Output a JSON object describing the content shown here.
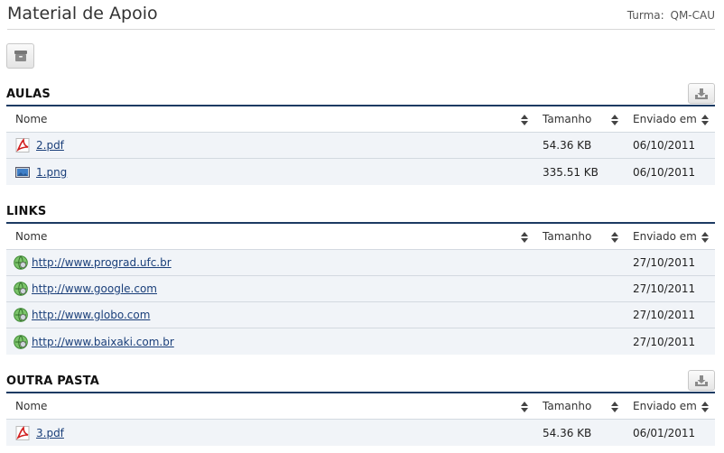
{
  "header": {
    "title": "Material de Apoio",
    "turma_label": "Turma:",
    "turma_value": "QM-CAU"
  },
  "toolbar": {
    "icon": "archive-icon"
  },
  "columns": {
    "name": "Nome",
    "size": "Tamanho",
    "date": "Enviado em"
  },
  "sections": [
    {
      "title": "AULAS",
      "rows": [
        {
          "icon": "pdf-icon",
          "name": "2.pdf",
          "size": "54.36 KB",
          "date": "06/10/2011"
        },
        {
          "icon": "image-icon",
          "name": "1.png",
          "size": "335.51 KB",
          "date": "06/10/2011"
        }
      ]
    },
    {
      "title": "LINKS",
      "rows": [
        {
          "icon": "link-icon",
          "name": "http://www.prograd.ufc.br",
          "size": "",
          "date": "27/10/2011"
        },
        {
          "icon": "link-icon",
          "name": "http://www.google.com",
          "size": "",
          "date": "27/10/2011"
        },
        {
          "icon": "link-icon",
          "name": "http://www.globo.com",
          "size": "",
          "date": "27/10/2011"
        },
        {
          "icon": "link-icon",
          "name": "http://www.baixaki.com.br",
          "size": "",
          "date": "27/10/2011"
        }
      ]
    },
    {
      "title": "OUTRA PASTA",
      "rows": [
        {
          "icon": "pdf-icon",
          "name": "3.pdf",
          "size": "54.36 KB",
          "date": "06/01/2011"
        }
      ]
    }
  ]
}
